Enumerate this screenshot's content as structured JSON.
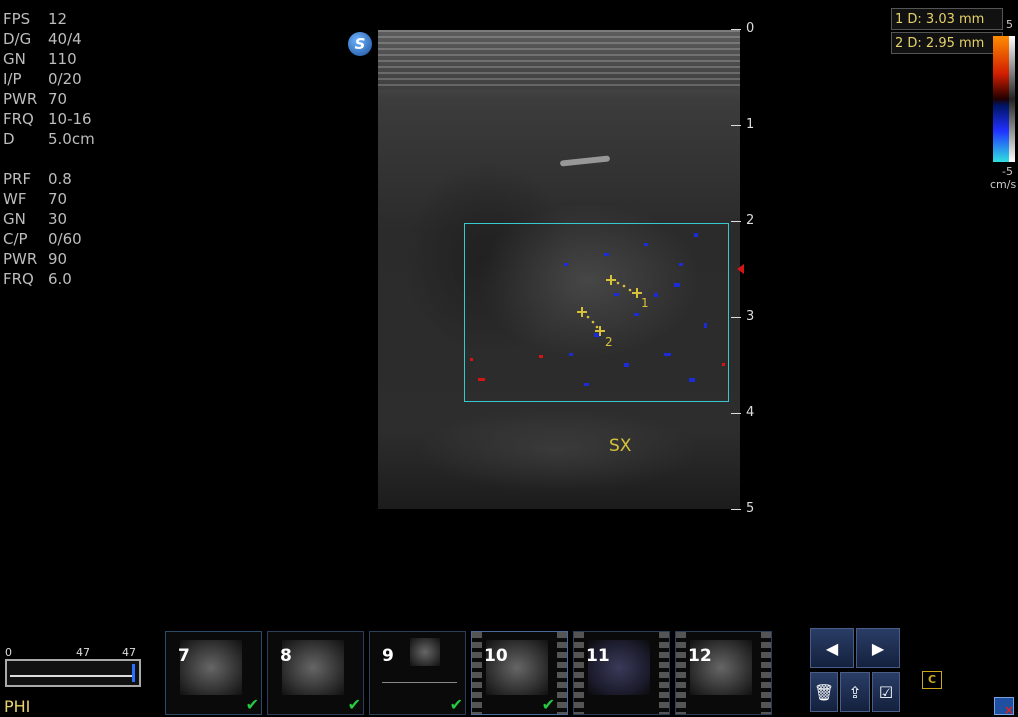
{
  "params_top": [
    {
      "k": "FPS",
      "v": "12"
    },
    {
      "k": "D/G",
      "v": "40/4"
    },
    {
      "k": "GN",
      "v": "110"
    },
    {
      "k": "I/P",
      "v": "0/20"
    },
    {
      "k": "PWR",
      "v": "70"
    },
    {
      "k": "FRQ",
      "v": "10-16"
    },
    {
      "k": "D",
      "v": "5.0cm"
    }
  ],
  "params_bottom": [
    {
      "k": "PRF",
      "v": "0.8"
    },
    {
      "k": "WF",
      "v": "70"
    },
    {
      "k": "GN",
      "v": "30"
    },
    {
      "k": "C/P",
      "v": "0/60"
    },
    {
      "k": "PWR",
      "v": "90"
    },
    {
      "k": "FRQ",
      "v": "6.0"
    }
  ],
  "logo": "S",
  "depth_labels": [
    "0",
    "1",
    "2",
    "3",
    "4",
    "5"
  ],
  "annotation": "SX",
  "measurements": [
    "1  D: 3.03   mm",
    "2  D: 2.95   mm"
  ],
  "caliper_labels": [
    "1",
    "2"
  ],
  "scale": {
    "top": "5",
    "bottom": "-5",
    "unit": "cm/s"
  },
  "phi": {
    "label": "PHI",
    "min": "0",
    "mid": "47",
    "max": "47"
  },
  "thumbnails": [
    {
      "num": "7",
      "checked": true
    },
    {
      "num": "8",
      "checked": true
    },
    {
      "num": "9",
      "checked": true
    },
    {
      "num": "10",
      "checked": true
    },
    {
      "num": "11",
      "checked": false
    },
    {
      "num": "12",
      "checked": false
    }
  ],
  "controls": {
    "prev": "◀",
    "next": "▶",
    "delete": "🗑",
    "export": "⇪",
    "list": "☑",
    "clip": "C"
  },
  "colors": {
    "box": "#38c8d0",
    "caliper": "#d8c23a",
    "thumb_check": "#27c93f"
  }
}
